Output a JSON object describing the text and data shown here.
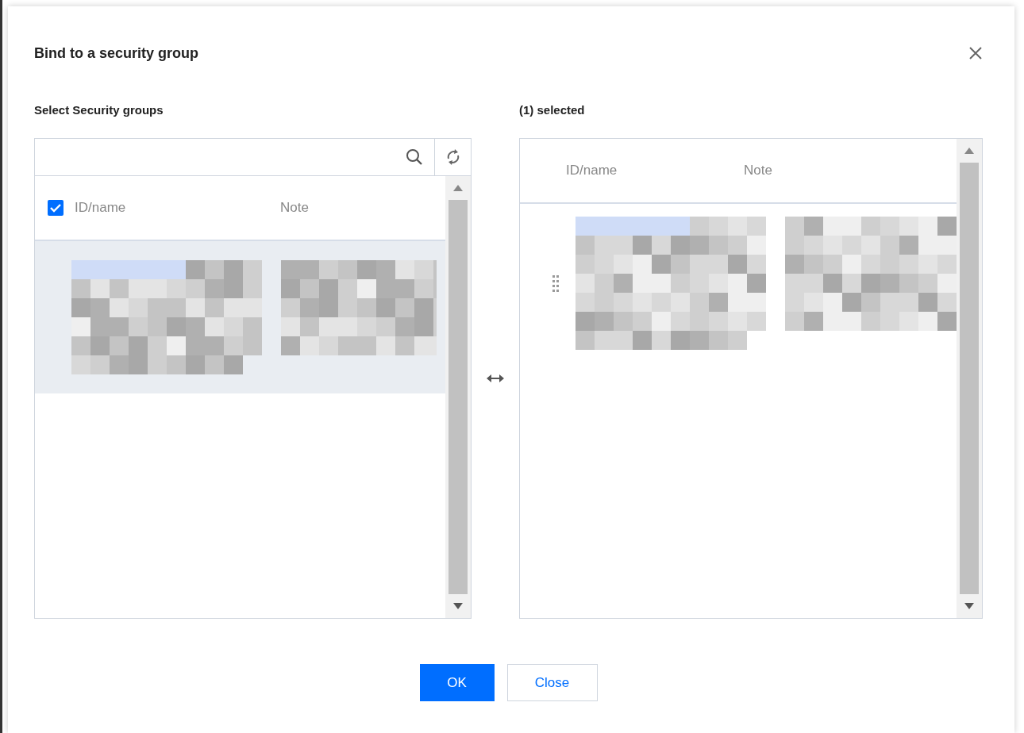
{
  "dialog": {
    "title": "Bind to a security group"
  },
  "source": {
    "heading": "Select Security groups",
    "all_checked": true,
    "columns": [
      "ID/name",
      "Note"
    ],
    "rows": [
      {
        "kind": "redacted",
        "selected": true
      }
    ]
  },
  "target": {
    "heading": "(1) selected",
    "columns": [
      "ID/name",
      "Note"
    ],
    "rows": [
      {
        "kind": "redacted",
        "selected": false
      }
    ]
  },
  "buttons": [
    {
      "label": "OK",
      "kind": "primary"
    },
    {
      "label": "Close",
      "kind": "secondary"
    }
  ]
}
